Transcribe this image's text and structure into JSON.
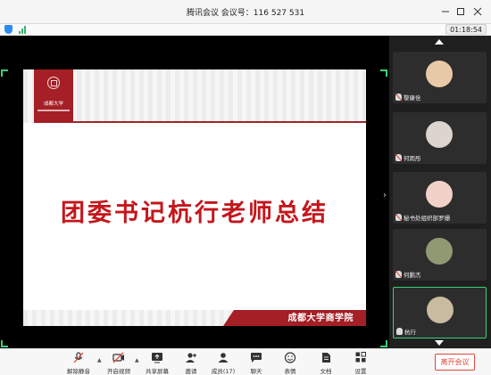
{
  "window": {
    "title": "腾讯会议  会议号：116 527 531",
    "controls": [
      "minimize-icon",
      "maximize-icon",
      "close-icon"
    ]
  },
  "statusbar": {
    "timer": "01:18:54",
    "icons": [
      "shield-icon",
      "signal-icon"
    ]
  },
  "slide": {
    "logo_text": "成都大学",
    "title": "团委书记杭行老师总结",
    "footer": "成都大学商学院"
  },
  "participants": [
    {
      "name": "黎康佺",
      "mic": "muted-red",
      "avatar_color": "#e8c9a8"
    },
    {
      "name": "何雨彤",
      "mic": "muted-red",
      "avatar_color": "#ddd4cf"
    },
    {
      "name": "秘书处组织部罗姗",
      "mic": "muted-red",
      "avatar_color": "#f1d2c8"
    },
    {
      "name": "何鹏杰",
      "mic": "muted-red",
      "avatar_color": "#8f9a72"
    },
    {
      "name": "杭行",
      "mic": "on",
      "avatar_color": "#c9bba0"
    }
  ],
  "toolbar": {
    "unmute": "解除静音",
    "start_video": "开启视频",
    "share_screen": "共享屏幕",
    "invite": "邀请",
    "members": "成员(17)",
    "chat": "聊天",
    "reactions": "表情",
    "docs": "文档",
    "settings": "设置",
    "leave": "离开会议"
  },
  "colors": {
    "accent_red": "#c4161c",
    "leave_red": "#e0453a",
    "active_green": "#3ad17a"
  }
}
